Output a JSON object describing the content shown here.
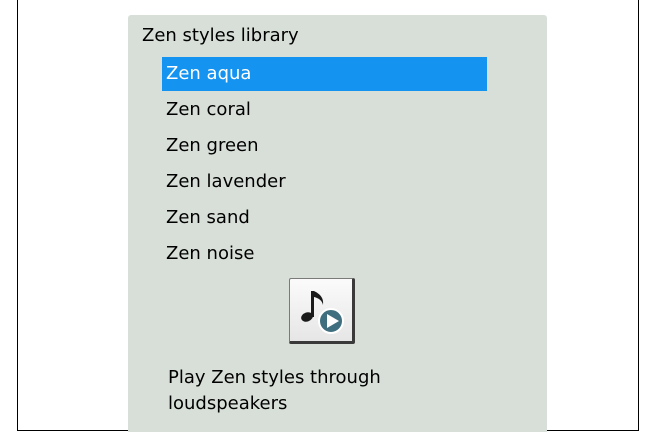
{
  "panel": {
    "title": "Zen styles library"
  },
  "styles": {
    "items": [
      {
        "label": "Zen aqua",
        "selected": true
      },
      {
        "label": "Zen coral",
        "selected": false
      },
      {
        "label": "Zen green",
        "selected": false
      },
      {
        "label": "Zen lavender",
        "selected": false
      },
      {
        "label": "Zen sand",
        "selected": false
      },
      {
        "label": "Zen noise",
        "selected": false
      }
    ],
    "selected_color": "#1593f0"
  },
  "play": {
    "icon": "music-note-play-icon",
    "caption": "Play Zen styles through loudspeakers"
  },
  "colors": {
    "panel_background": "#d8dfd8",
    "play_badge": "#3f6f7f"
  }
}
